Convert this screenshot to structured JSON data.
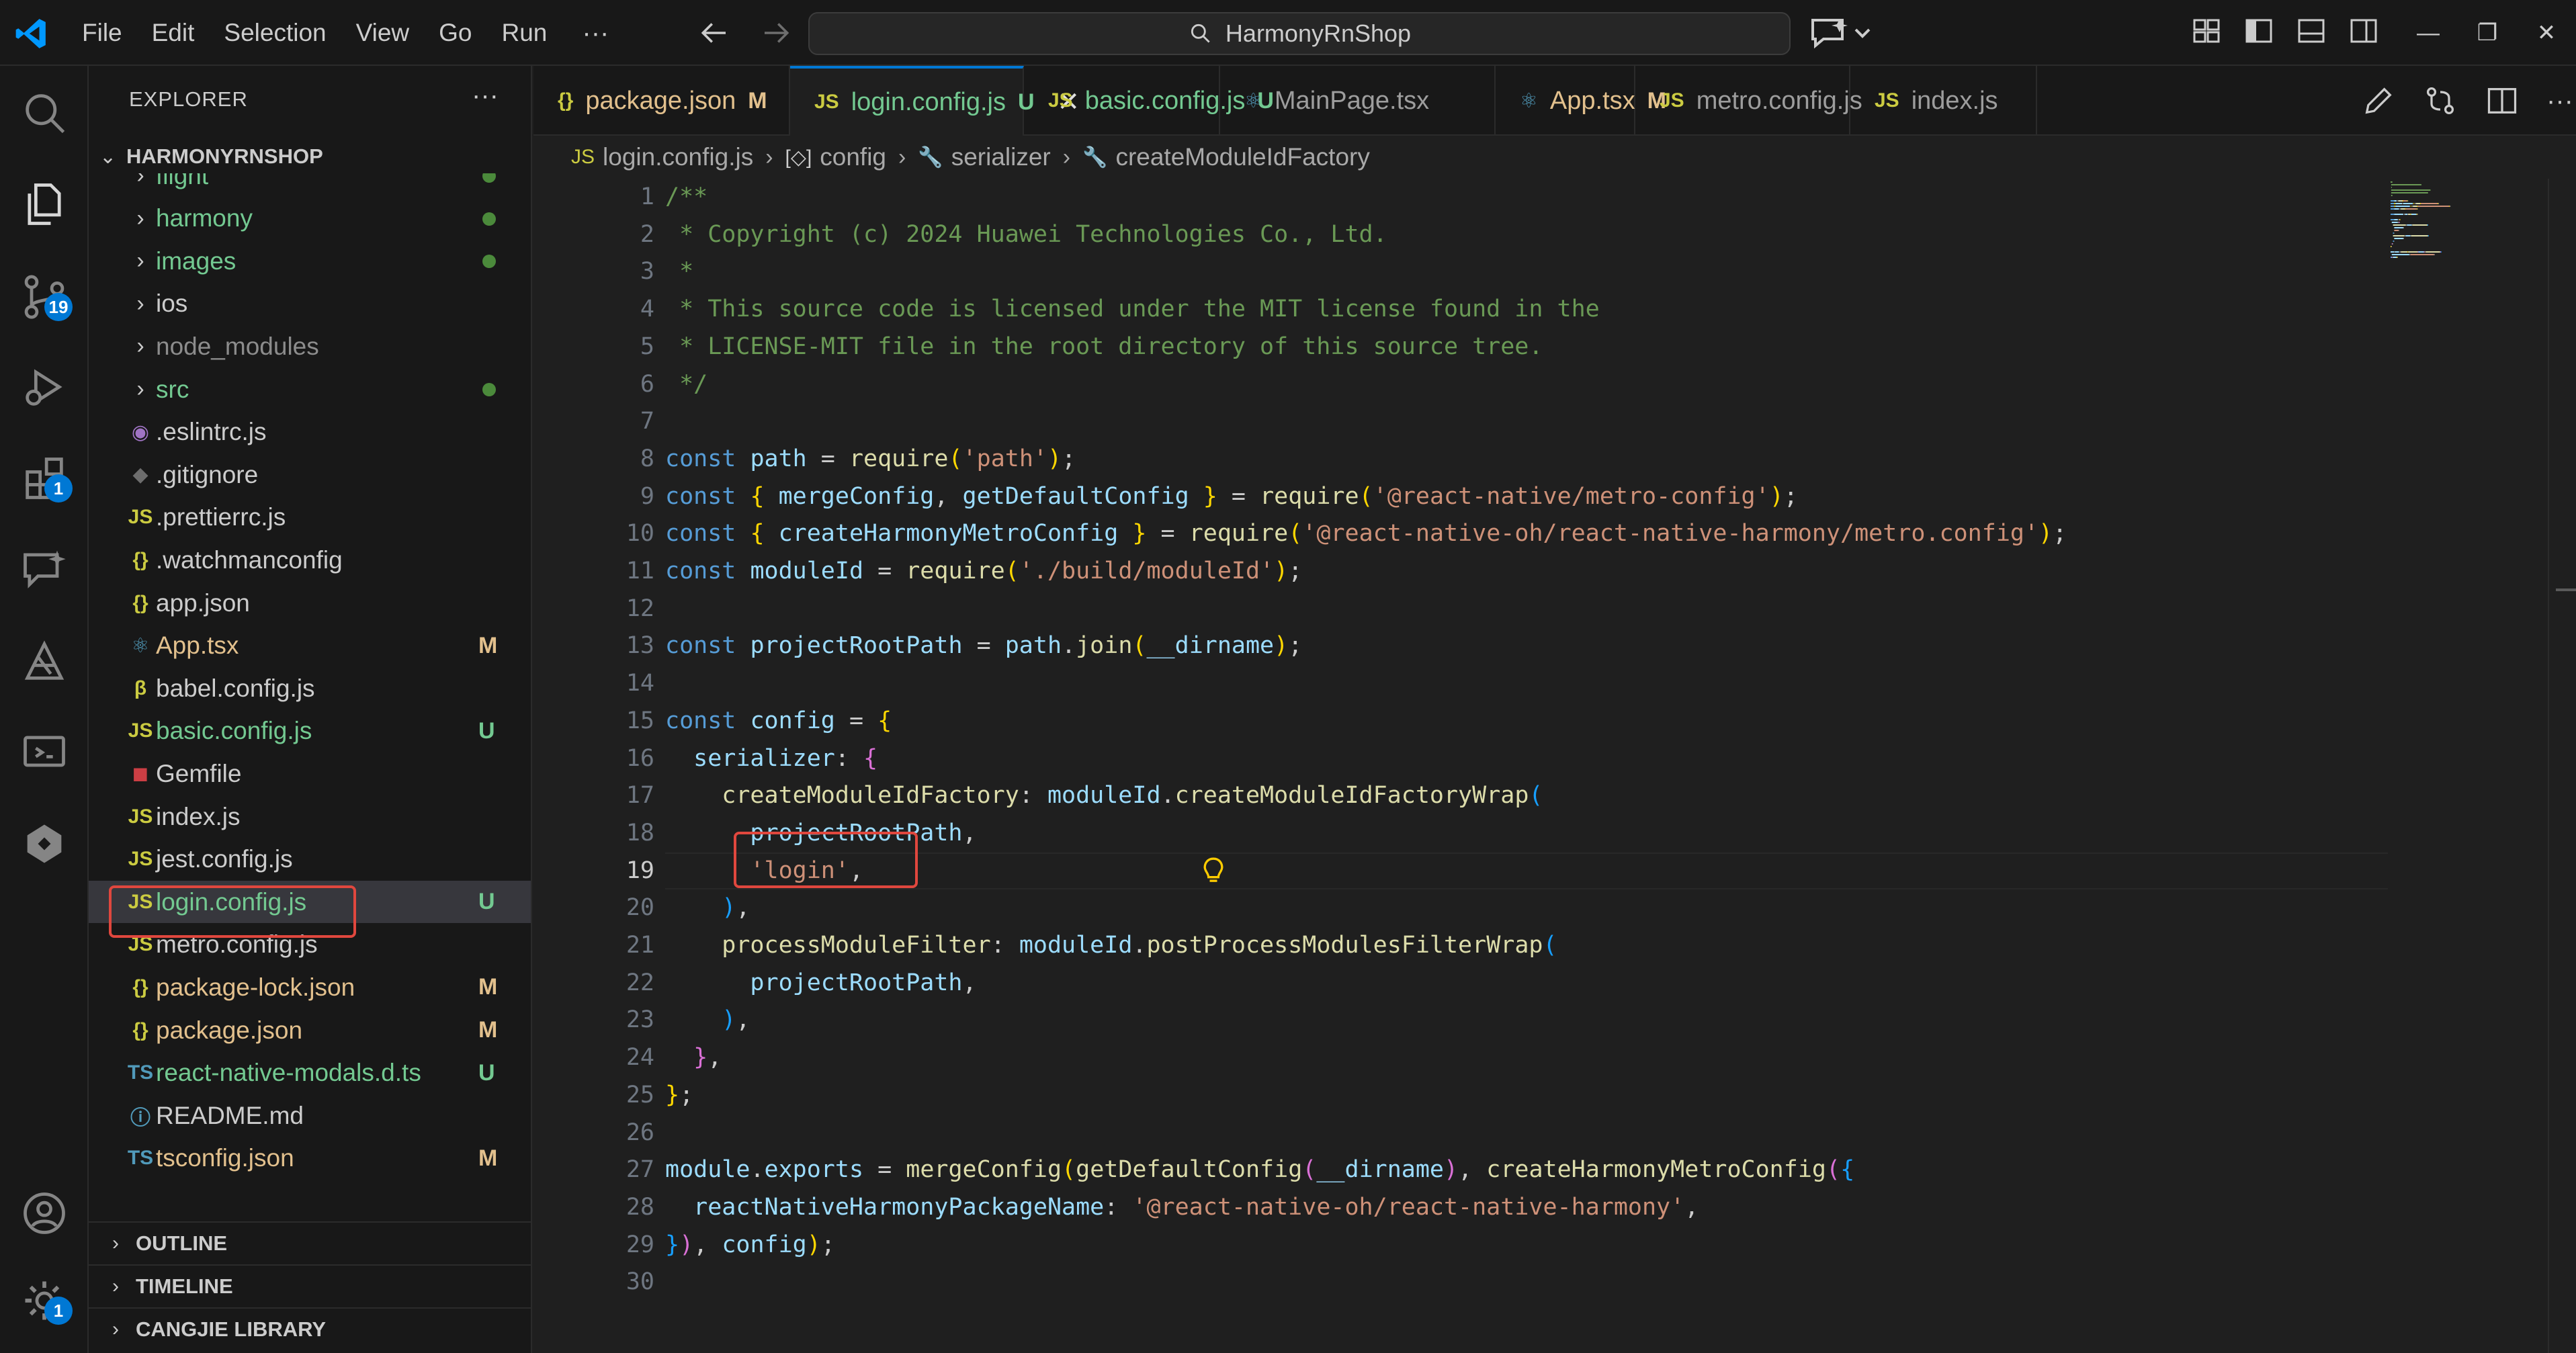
{
  "titlebar": {
    "menus": [
      "File",
      "Edit",
      "Selection",
      "View",
      "Go",
      "Run"
    ],
    "menu_more": "···",
    "search_text": "HarmonyRnShop",
    "window_controls": {
      "minimize": "—",
      "restore": "❐",
      "close": "✕"
    }
  },
  "activitybar": {
    "items": [
      {
        "icon": "search-icon"
      },
      {
        "icon": "files-icon"
      },
      {
        "icon": "source-control-icon",
        "badge": "19"
      },
      {
        "icon": "run-debug-icon"
      },
      {
        "icon": "extensions-icon",
        "badge": "1"
      },
      {
        "icon": "chat-icon"
      },
      {
        "icon": "deveco-icon"
      },
      {
        "icon": "remote-explorer-icon"
      },
      {
        "icon": "harmony-icon"
      }
    ],
    "bottom": [
      {
        "icon": "accounts-icon"
      },
      {
        "icon": "manage-gear-icon",
        "badge": "1"
      }
    ]
  },
  "explorer": {
    "title": "EXPLORER",
    "more": "···",
    "root": "HARMONYRNSHOP",
    "items": [
      {
        "label": "flight",
        "type": "folder",
        "color": "#73c991",
        "dot": true
      },
      {
        "label": "harmony",
        "type": "folder",
        "color": "#73c991",
        "dot": true
      },
      {
        "label": "images",
        "type": "folder",
        "color": "#73c991",
        "dot": true
      },
      {
        "label": "ios",
        "type": "folder",
        "color": "#cccccc",
        "dot": false
      },
      {
        "label": "node_modules",
        "type": "folder",
        "color": "#8c8c8c",
        "dot": false
      },
      {
        "label": "src",
        "type": "folder",
        "color": "#73c991",
        "dot": true
      },
      {
        "label": ".eslintrc.js",
        "icon": "◉",
        "icon_color": "#a074c4",
        "color": "#cccccc",
        "status": ""
      },
      {
        "label": ".gitignore",
        "icon": "◆",
        "icon_color": "#6d6d6d",
        "color": "#cccccc",
        "status": ""
      },
      {
        "label": ".prettierrc.js",
        "icon": "JS",
        "icon_color": "#cbcb41",
        "color": "#cccccc",
        "status": ""
      },
      {
        "label": ".watchmanconfig",
        "icon": "{}",
        "icon_color": "#cbcb41",
        "color": "#cccccc",
        "status": ""
      },
      {
        "label": "app.json",
        "icon": "{}",
        "icon_color": "#cbcb41",
        "color": "#cccccc",
        "status": ""
      },
      {
        "label": "App.tsx",
        "icon": "⚛",
        "icon_color": "#519aba",
        "color": "#e2c08d",
        "status": "M"
      },
      {
        "label": "babel.config.js",
        "icon": "β",
        "icon_color": "#cbcb41",
        "color": "#cccccc",
        "status": ""
      },
      {
        "label": "basic.config.js",
        "icon": "JS",
        "icon_color": "#cbcb41",
        "color": "#73c991",
        "status": "U"
      },
      {
        "label": "Gemfile",
        "icon": "◼",
        "icon_color": "#cc3e44",
        "color": "#cccccc",
        "status": ""
      },
      {
        "label": "index.js",
        "icon": "JS",
        "icon_color": "#cbcb41",
        "color": "#cccccc",
        "status": ""
      },
      {
        "label": "jest.config.js",
        "icon": "JS",
        "icon_color": "#cbcb41",
        "color": "#cccccc",
        "status": ""
      },
      {
        "label": "login.config.js",
        "icon": "JS",
        "icon_color": "#cbcb41",
        "color": "#73c991",
        "status": "U",
        "selected": true
      },
      {
        "label": "metro.config.js",
        "icon": "JS",
        "icon_color": "#cbcb41",
        "color": "#cccccc",
        "status": ""
      },
      {
        "label": "package-lock.json",
        "icon": "{}",
        "icon_color": "#cbcb41",
        "color": "#e2c08d",
        "status": "M"
      },
      {
        "label": "package.json",
        "icon": "{}",
        "icon_color": "#cbcb41",
        "color": "#e2c08d",
        "status": "M"
      },
      {
        "label": "react-native-modals.d.ts",
        "icon": "TS",
        "icon_color": "#519aba",
        "color": "#73c991",
        "status": "U"
      },
      {
        "label": "README.md",
        "icon": "ⓘ",
        "icon_color": "#519aba",
        "color": "#cccccc",
        "status": ""
      },
      {
        "label": "tsconfig.json",
        "icon": "TS",
        "icon_color": "#519aba",
        "color": "#e2c08d",
        "status": "M"
      }
    ],
    "sections": [
      "OUTLINE",
      "TIMELINE",
      "CANGJIE LIBRARY"
    ]
  },
  "tabs": [
    {
      "label": "package.json",
      "icon": "{}",
      "icon_color": "#cbcb41",
      "color": "#e2c08d",
      "status": "M"
    },
    {
      "label": "login.config.js",
      "icon": "JS",
      "icon_color": "#cbcb41",
      "color": "#73c991",
      "status": "U",
      "active": true,
      "close": "✕"
    },
    {
      "label": "basic.config.js",
      "icon": "JS",
      "icon_color": "#cbcb41",
      "color": "#73c991",
      "status": "U"
    },
    {
      "label": "MainPage.tsx",
      "icon": "⚛",
      "icon_color": "#519aba",
      "color": "#9d9d9d",
      "status": ""
    },
    {
      "label": "App.tsx",
      "icon": "⚛",
      "icon_color": "#519aba",
      "color": "#e2c08d",
      "status": "M"
    },
    {
      "label": "metro.config.js",
      "icon": "JS",
      "icon_color": "#cbcb41",
      "color": "#9d9d9d",
      "status": ""
    },
    {
      "label": "index.js",
      "icon": "JS",
      "icon_color": "#cbcb41",
      "color": "#9d9d9d",
      "status": ""
    }
  ],
  "breadcrumb": [
    {
      "label": "login.config.js",
      "icon": "JS"
    },
    {
      "label": "config",
      "icon": "[◇]"
    },
    {
      "label": "serializer",
      "icon": "🔧"
    },
    {
      "label": "createModuleIdFactory",
      "icon": "🔧"
    }
  ],
  "editor": {
    "current_line": 19,
    "lines": [
      [
        [
          "/**",
          "c"
        ]
      ],
      [
        [
          " * Copyright (c) 2024 Huawei Technologies Co., Ltd.",
          "c"
        ]
      ],
      [
        [
          " *",
          "c"
        ]
      ],
      [
        [
          " * This source code is licensed under the MIT license found in the",
          "c"
        ]
      ],
      [
        [
          " * LICENSE-MIT file in the root directory of this source tree.",
          "c"
        ]
      ],
      [
        [
          " */",
          "c"
        ]
      ],
      [],
      [
        [
          "const ",
          "k"
        ],
        [
          "path",
          "v"
        ],
        [
          " = ",
          "p"
        ],
        [
          "require",
          "f"
        ],
        [
          "(",
          "b1"
        ],
        [
          "'path'",
          "s"
        ],
        [
          ")",
          "b1"
        ],
        [
          ";",
          "p"
        ]
      ],
      [
        [
          "const ",
          "k"
        ],
        [
          "{ ",
          "b1"
        ],
        [
          "mergeConfig",
          "v"
        ],
        [
          ", ",
          "p"
        ],
        [
          "getDefaultConfig",
          "v"
        ],
        [
          " }",
          "b1"
        ],
        [
          " = ",
          "p"
        ],
        [
          "require",
          "f"
        ],
        [
          "(",
          "b1"
        ],
        [
          "'@react-native/metro-config'",
          "s"
        ],
        [
          ")",
          "b1"
        ],
        [
          ";",
          "p"
        ]
      ],
      [
        [
          "const ",
          "k"
        ],
        [
          "{ ",
          "b1"
        ],
        [
          "createHarmonyMetroConfig",
          "v"
        ],
        [
          " }",
          "b1"
        ],
        [
          " = ",
          "p"
        ],
        [
          "require",
          "f"
        ],
        [
          "(",
          "b1"
        ],
        [
          "'@react-native-oh/react-native-harmony/metro.config'",
          "s"
        ],
        [
          ")",
          "b1"
        ],
        [
          ";",
          "p"
        ]
      ],
      [
        [
          "const ",
          "k"
        ],
        [
          "moduleId",
          "v"
        ],
        [
          " = ",
          "p"
        ],
        [
          "require",
          "f"
        ],
        [
          "(",
          "b1"
        ],
        [
          "'./build/moduleId'",
          "s"
        ],
        [
          ")",
          "b1"
        ],
        [
          ";",
          "p"
        ]
      ],
      [],
      [
        [
          "const ",
          "k"
        ],
        [
          "projectRootPath",
          "v"
        ],
        [
          " = ",
          "p"
        ],
        [
          "path",
          "v"
        ],
        [
          ".",
          "p"
        ],
        [
          "join",
          "f"
        ],
        [
          "(",
          "b1"
        ],
        [
          "__dirname",
          "v"
        ],
        [
          ")",
          "b1"
        ],
        [
          ";",
          "p"
        ]
      ],
      [],
      [
        [
          "const ",
          "k"
        ],
        [
          "config",
          "v"
        ],
        [
          " = ",
          "p"
        ],
        [
          "{",
          "b1"
        ]
      ],
      [
        [
          "  serializer",
          "v"
        ],
        [
          ": ",
          "p"
        ],
        [
          "{",
          "b2"
        ]
      ],
      [
        [
          "    createModuleIdFactory",
          "f"
        ],
        [
          ": ",
          "p"
        ],
        [
          "moduleId",
          "v"
        ],
        [
          ".",
          "p"
        ],
        [
          "createModuleIdFactoryWrap",
          "f"
        ],
        [
          "(",
          "b3"
        ]
      ],
      [
        [
          "      projectRootPath",
          "v"
        ],
        [
          ",",
          "p"
        ]
      ],
      [
        [
          "      'login'",
          "s"
        ],
        [
          ",",
          "p"
        ]
      ],
      [
        [
          "    ",
          "p"
        ],
        [
          ")",
          "b3"
        ],
        [
          ",",
          "p"
        ]
      ],
      [
        [
          "    processModuleFilter",
          "f"
        ],
        [
          ": ",
          "p"
        ],
        [
          "moduleId",
          "v"
        ],
        [
          ".",
          "p"
        ],
        [
          "postProcessModulesFilterWrap",
          "f"
        ],
        [
          "(",
          "b3"
        ]
      ],
      [
        [
          "      projectRootPath",
          "v"
        ],
        [
          ",",
          "p"
        ]
      ],
      [
        [
          "    ",
          "p"
        ],
        [
          ")",
          "b3"
        ],
        [
          ",",
          "p"
        ]
      ],
      [
        [
          "  ",
          "p"
        ],
        [
          "}",
          "b2"
        ],
        [
          ",",
          "p"
        ]
      ],
      [
        [
          "}",
          "b1"
        ],
        [
          ";",
          "p"
        ]
      ],
      [],
      [
        [
          "module",
          "v"
        ],
        [
          ".",
          "p"
        ],
        [
          "exports",
          "v"
        ],
        [
          " = ",
          "p"
        ],
        [
          "mergeConfig",
          "f"
        ],
        [
          "(",
          "b1"
        ],
        [
          "getDefaultConfig",
          "f"
        ],
        [
          "(",
          "b2"
        ],
        [
          "__dirname",
          "v"
        ],
        [
          ")",
          "b2"
        ],
        [
          ", ",
          "p"
        ],
        [
          "createHarmonyMetroConfig",
          "f"
        ],
        [
          "(",
          "b2"
        ],
        [
          "{",
          "b3"
        ]
      ],
      [
        [
          "  reactNativeHarmonyPackageName",
          "v"
        ],
        [
          ": ",
          "p"
        ],
        [
          "'@react-native-oh/react-native-harmony'",
          "s"
        ],
        [
          ",",
          "p"
        ]
      ],
      [
        [
          "}",
          "b3"
        ],
        [
          ")",
          "b2"
        ],
        [
          ", ",
          "p"
        ],
        [
          "config",
          "v"
        ],
        [
          ")",
          "b1"
        ],
        [
          ";",
          "p"
        ]
      ],
      []
    ]
  },
  "colors": {
    "accent": "#0078d4",
    "highlight_box": "#e0473e",
    "untracked": "#73c991",
    "modified": "#e2c08d"
  }
}
